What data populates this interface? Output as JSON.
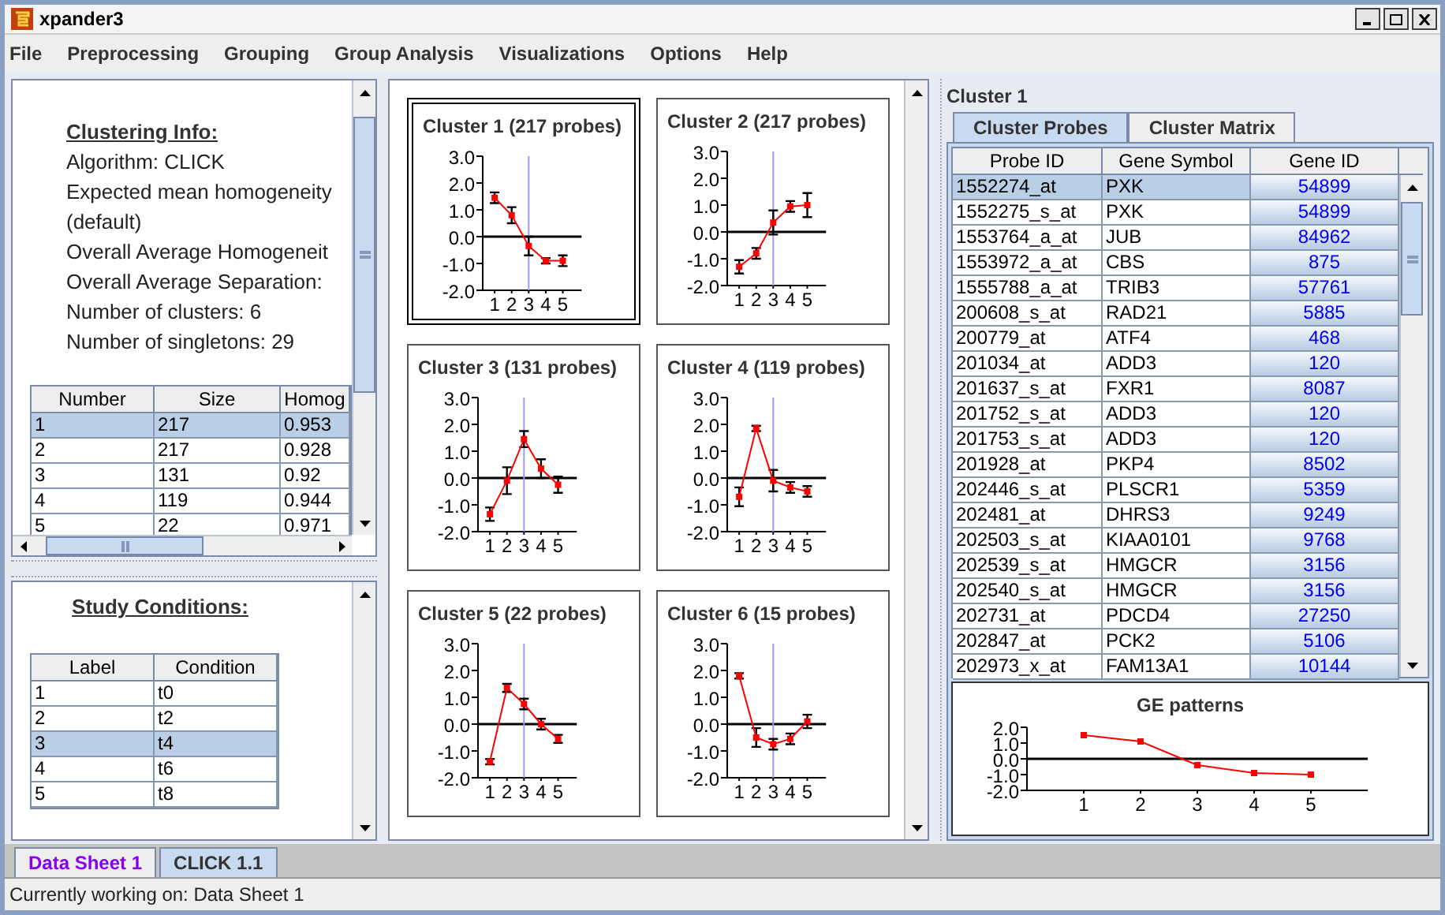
{
  "window": {
    "title": "xpander3"
  },
  "menu": [
    {
      "label": "File"
    },
    {
      "label": "Preprocessing"
    },
    {
      "label": "Grouping"
    },
    {
      "label": "Group Analysis"
    },
    {
      "label": "Visualizations"
    },
    {
      "label": "Options"
    },
    {
      "label": "Help"
    }
  ],
  "clustering_info": {
    "heading": "Clustering Info:",
    "lines": [
      "Algorithm: CLICK",
      "Expected mean homogeneity",
      "(default)",
      "Overall Average Homogeneit",
      "Overall Average Separation:",
      "Number of clusters: 6",
      "Number of singletons: 29"
    ]
  },
  "clusters_table": {
    "columns": [
      "Number",
      "Size",
      "Homog"
    ],
    "rows": [
      {
        "cells": [
          "1",
          "217",
          "0.953"
        ],
        "selected": true
      },
      {
        "cells": [
          "2",
          "217",
          "0.928"
        ],
        "selected": false
      },
      {
        "cells": [
          "3",
          "131",
          "0.92"
        ],
        "selected": false
      },
      {
        "cells": [
          "4",
          "119",
          "0.944"
        ],
        "selected": false
      },
      {
        "cells": [
          "5",
          "22",
          "0.971"
        ],
        "selected": false
      }
    ]
  },
  "study_conditions": {
    "heading": "Study Conditions:",
    "columns": [
      "Label",
      "Condition"
    ],
    "rows": [
      {
        "cells": [
          "1",
          "t0"
        ],
        "selected": false
      },
      {
        "cells": [
          "2",
          "t2"
        ],
        "selected": false
      },
      {
        "cells": [
          "3",
          "t4"
        ],
        "selected": true
      },
      {
        "cells": [
          "4",
          "t6"
        ],
        "selected": false
      },
      {
        "cells": [
          "5",
          "t8"
        ],
        "selected": false
      }
    ]
  },
  "cluster_charts": [
    {
      "selected": true,
      "chart_data": {
        "type": "line",
        "title": "Cluster 1 (217 probes)",
        "x": [
          1,
          2,
          3,
          4,
          5
        ],
        "xlim": [
          0.3,
          6.1
        ],
        "xticks": [
          1,
          2,
          3,
          4,
          5
        ],
        "ylim": [
          -2,
          3
        ],
        "yticks": [
          {
            "value": 3,
            "label": "3.0"
          },
          {
            "value": 2,
            "label": "2.0"
          },
          {
            "value": 1,
            "label": "1.0"
          },
          {
            "value": 0,
            "label": "0.0"
          },
          {
            "value": -1,
            "label": "-1.0"
          },
          {
            "value": -2,
            "label": "-2.0"
          }
        ],
        "ref_lines": [
          {
            "axis": "x",
            "value": 3,
            "color": "#9999ff"
          }
        ],
        "series": [
          {
            "color": "#ff0000",
            "marker": "square",
            "values": [
              1.45,
              0.8,
              -0.35,
              -0.9,
              -0.9
            ],
            "errors": [
              0.2,
              0.3,
              0.35,
              0.1,
              0.2
            ]
          }
        ]
      }
    },
    {
      "selected": false,
      "chart_data": {
        "type": "line",
        "title": "Cluster 2 (217 probes)",
        "x": [
          1,
          2,
          3,
          4,
          5
        ],
        "xlim": [
          0.3,
          6.1
        ],
        "xticks": [
          1,
          2,
          3,
          4,
          5
        ],
        "ylim": [
          -2,
          3
        ],
        "yticks": [
          {
            "value": 3,
            "label": "3.0"
          },
          {
            "value": 2,
            "label": "2.0"
          },
          {
            "value": 1,
            "label": "1.0"
          },
          {
            "value": 0,
            "label": "0.0"
          },
          {
            "value": -1,
            "label": "-1.0"
          },
          {
            "value": -2,
            "label": "-2.0"
          }
        ],
        "ref_lines": [
          {
            "axis": "x",
            "value": 3,
            "color": "#9999ff"
          }
        ],
        "series": [
          {
            "color": "#ff0000",
            "marker": "square",
            "values": [
              -1.3,
              -0.8,
              0.35,
              0.95,
              1.0
            ],
            "errors": [
              0.25,
              0.2,
              0.45,
              0.2,
              0.45
            ]
          }
        ]
      }
    },
    {
      "selected": false,
      "chart_data": {
        "type": "line",
        "title": "Cluster 3 (131 probes)",
        "x": [
          1,
          2,
          3,
          4,
          5
        ],
        "xlim": [
          0.3,
          6.1
        ],
        "xticks": [
          1,
          2,
          3,
          4,
          5
        ],
        "ylim": [
          -2,
          3
        ],
        "yticks": [
          {
            "value": 3,
            "label": "3.0"
          },
          {
            "value": 2,
            "label": "2.0"
          },
          {
            "value": 1,
            "label": "1.0"
          },
          {
            "value": 0,
            "label": "0.0"
          },
          {
            "value": -1,
            "label": "-1.0"
          },
          {
            "value": -2,
            "label": "-2.0"
          }
        ],
        "ref_lines": [
          {
            "axis": "x",
            "value": 3,
            "color": "#9999ff"
          }
        ],
        "series": [
          {
            "color": "#ff0000",
            "marker": "square",
            "values": [
              -1.35,
              -0.1,
              1.45,
              0.35,
              -0.25
            ],
            "errors": [
              0.25,
              0.5,
              0.3,
              0.35,
              0.3
            ]
          }
        ]
      }
    },
    {
      "selected": false,
      "chart_data": {
        "type": "line",
        "title": "Cluster 4 (119 probes)",
        "x": [
          1,
          2,
          3,
          4,
          5
        ],
        "xlim": [
          0.3,
          6.1
        ],
        "xticks": [
          1,
          2,
          3,
          4,
          5
        ],
        "ylim": [
          -2,
          3
        ],
        "yticks": [
          {
            "value": 3,
            "label": "3.0"
          },
          {
            "value": 2,
            "label": "2.0"
          },
          {
            "value": 1,
            "label": "1.0"
          },
          {
            "value": 0,
            "label": "0.0"
          },
          {
            "value": -1,
            "label": "-1.0"
          },
          {
            "value": -2,
            "label": "-2.0"
          }
        ],
        "ref_lines": [
          {
            "axis": "x",
            "value": 3,
            "color": "#9999ff"
          }
        ],
        "series": [
          {
            "color": "#ff0000",
            "marker": "square",
            "values": [
              -0.7,
              1.85,
              -0.1,
              -0.35,
              -0.5
            ],
            "errors": [
              0.35,
              0.1,
              0.4,
              0.2,
              0.2
            ]
          }
        ]
      }
    },
    {
      "selected": false,
      "chart_data": {
        "type": "line",
        "title": "Cluster 5 (22 probes)",
        "x": [
          1,
          2,
          3,
          4,
          5
        ],
        "xlim": [
          0.3,
          6.1
        ],
        "xticks": [
          1,
          2,
          3,
          4,
          5
        ],
        "ylim": [
          -2,
          3
        ],
        "yticks": [
          {
            "value": 3,
            "label": "3.0"
          },
          {
            "value": 2,
            "label": "2.0"
          },
          {
            "value": 1,
            "label": "1.0"
          },
          {
            "value": 0,
            "label": "0.0"
          },
          {
            "value": -1,
            "label": "-1.0"
          },
          {
            "value": -2,
            "label": "-2.0"
          }
        ],
        "ref_lines": [
          {
            "axis": "x",
            "value": 3,
            "color": "#9999ff"
          }
        ],
        "series": [
          {
            "color": "#ff0000",
            "marker": "square",
            "values": [
              -1.4,
              1.35,
              0.75,
              0.0,
              -0.55
            ],
            "errors": [
              0.1,
              0.15,
              0.2,
              0.2,
              0.15
            ]
          }
        ]
      }
    },
    {
      "selected": false,
      "chart_data": {
        "type": "line",
        "title": "Cluster 6 (15 probes)",
        "x": [
          1,
          2,
          3,
          4,
          5
        ],
        "xlim": [
          0.3,
          6.1
        ],
        "xticks": [
          1,
          2,
          3,
          4,
          5
        ],
        "ylim": [
          -2,
          3
        ],
        "yticks": [
          {
            "value": 3,
            "label": "3.0"
          },
          {
            "value": 2,
            "label": "2.0"
          },
          {
            "value": 1,
            "label": "1.0"
          },
          {
            "value": 0,
            "label": "0.0"
          },
          {
            "value": -1,
            "label": "-1.0"
          },
          {
            "value": -2,
            "label": "-2.0"
          }
        ],
        "ref_lines": [
          {
            "axis": "x",
            "value": 3,
            "color": "#9999ff"
          }
        ],
        "series": [
          {
            "color": "#ff0000",
            "marker": "square",
            "values": [
              1.8,
              -0.5,
              -0.75,
              -0.55,
              0.1
            ],
            "errors": [
              0.1,
              0.35,
              0.2,
              0.2,
              0.25
            ]
          }
        ]
      }
    }
  ],
  "detail": {
    "title": "Cluster 1",
    "tabs": [
      {
        "label": "Cluster Probes",
        "selected": true
      },
      {
        "label": "Cluster Matrix",
        "selected": false
      }
    ],
    "table": {
      "columns": [
        "Probe ID",
        "Gene Symbol",
        "Gene ID"
      ],
      "rows": [
        {
          "cells": [
            "1552274_at",
            "PXK",
            "54899"
          ],
          "selected": true
        },
        {
          "cells": [
            "1552275_s_at",
            "PXK",
            "54899"
          ],
          "selected": false
        },
        {
          "cells": [
            "1553764_a_at",
            "JUB",
            "84962"
          ],
          "selected": false
        },
        {
          "cells": [
            "1553972_a_at",
            "CBS",
            "875"
          ],
          "selected": false
        },
        {
          "cells": [
            "1555788_a_at",
            "TRIB3",
            "57761"
          ],
          "selected": false
        },
        {
          "cells": [
            "200608_s_at",
            "RAD21",
            "5885"
          ],
          "selected": false
        },
        {
          "cells": [
            "200779_at",
            "ATF4",
            "468"
          ],
          "selected": false
        },
        {
          "cells": [
            "201034_at",
            "ADD3",
            "120"
          ],
          "selected": false
        },
        {
          "cells": [
            "201637_s_at",
            "FXR1",
            "8087"
          ],
          "selected": false
        },
        {
          "cells": [
            "201752_s_at",
            "ADD3",
            "120"
          ],
          "selected": false
        },
        {
          "cells": [
            "201753_s_at",
            "ADD3",
            "120"
          ],
          "selected": false
        },
        {
          "cells": [
            "201928_at",
            "PKP4",
            "8502"
          ],
          "selected": false
        },
        {
          "cells": [
            "202446_s_at",
            "PLSCR1",
            "5359"
          ],
          "selected": false
        },
        {
          "cells": [
            "202481_at",
            "DHRS3",
            "9249"
          ],
          "selected": false
        },
        {
          "cells": [
            "202503_s_at",
            "KIAA0101",
            "9768"
          ],
          "selected": false
        },
        {
          "cells": [
            "202539_s_at",
            "HMGCR",
            "3156"
          ],
          "selected": false
        },
        {
          "cells": [
            "202540_s_at",
            "HMGCR",
            "3156"
          ],
          "selected": false
        },
        {
          "cells": [
            "202731_at",
            "PDCD4",
            "27250"
          ],
          "selected": false
        },
        {
          "cells": [
            "202847_at",
            "PCK2",
            "5106"
          ],
          "selected": false
        },
        {
          "cells": [
            "202973_x_at",
            "FAM13A1",
            "10144"
          ],
          "selected": false
        }
      ]
    },
    "chart": {
      "chart_data": {
        "type": "line",
        "title": "GE patterns",
        "x": [
          1,
          2,
          3,
          4,
          5
        ],
        "xlim": [
          0,
          6
        ],
        "xticks": [
          1,
          2,
          3,
          4,
          5
        ],
        "ylim": [
          -2,
          2
        ],
        "yticks": [
          {
            "value": 2,
            "label": "2.0"
          },
          {
            "value": 1,
            "label": "1.0"
          },
          {
            "value": 0,
            "label": "0.0"
          },
          {
            "value": -1,
            "label": "-1.0"
          },
          {
            "value": -2,
            "label": "-2.0"
          }
        ],
        "series": [
          {
            "color": "#ff0000",
            "marker": "square",
            "values": [
              1.5,
              1.1,
              -0.4,
              -0.9,
              -1.0
            ]
          }
        ]
      }
    }
  },
  "sheet_tabs": [
    {
      "label": "Data Sheet 1",
      "selected": true
    },
    {
      "label": "CLICK 1.1",
      "selected": false
    }
  ],
  "status_bar": "Currently working on: Data Sheet 1"
}
